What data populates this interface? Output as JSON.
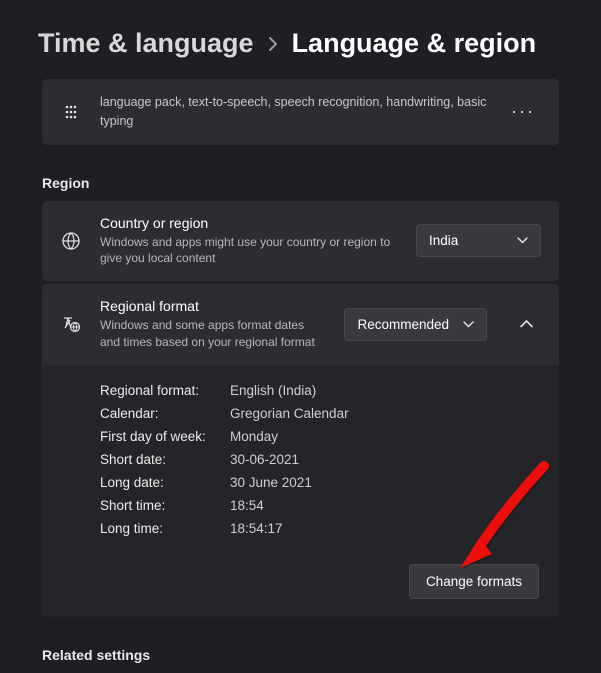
{
  "breadcrumb": {
    "parent": "Time & language",
    "current": "Language & region"
  },
  "language_card": {
    "description": "language pack, text-to-speech, speech recognition, handwriting, basic typing"
  },
  "region_section": {
    "title": "Region",
    "country": {
      "title": "Country or region",
      "description": "Windows and apps might use your country or region to give you local content",
      "selected": "India"
    },
    "format": {
      "title": "Regional format",
      "description": "Windows and some apps format dates and times based on your regional format",
      "selected": "Recommended",
      "details": {
        "regional_format_label": "Regional format:",
        "regional_format_value": "English (India)",
        "calendar_label": "Calendar:",
        "calendar_value": "Gregorian Calendar",
        "first_day_label": "First day of week:",
        "first_day_value": "Monday",
        "short_date_label": "Short date:",
        "short_date_value": "30-06-2021",
        "long_date_label": "Long date:",
        "long_date_value": "30 June 2021",
        "short_time_label": "Short time:",
        "short_time_value": "18:54",
        "long_time_label": "Long time:",
        "long_time_value": "18:54:17"
      },
      "change_button": "Change formats"
    }
  },
  "related_settings": {
    "title": "Related settings"
  }
}
